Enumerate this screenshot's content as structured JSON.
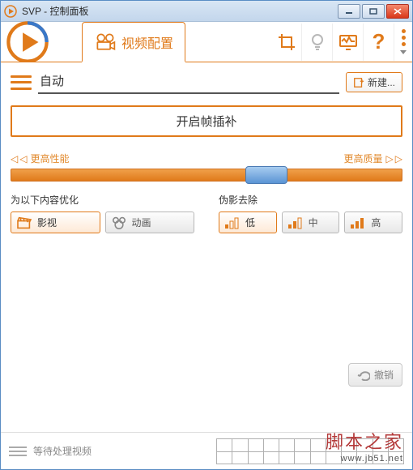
{
  "window": {
    "title": "SVP - 控制面板"
  },
  "tabs": {
    "video_config": "视频配置"
  },
  "profile": {
    "selected": "自动",
    "new_btn": "新建..."
  },
  "main_button": "开启帧插补",
  "slider": {
    "left_label": "更高性能",
    "right_label": "更高质量"
  },
  "optimize": {
    "title": "为以下内容优化",
    "movie": "影视",
    "anime": "动画"
  },
  "artifact": {
    "title": "伪影去除",
    "low": "低",
    "mid": "中",
    "high": "高"
  },
  "undo": "撤销",
  "footer": {
    "waiting": "等待处理视频"
  },
  "watermark": {
    "line1": "脚本之家",
    "line2": "www.jb51.net"
  }
}
